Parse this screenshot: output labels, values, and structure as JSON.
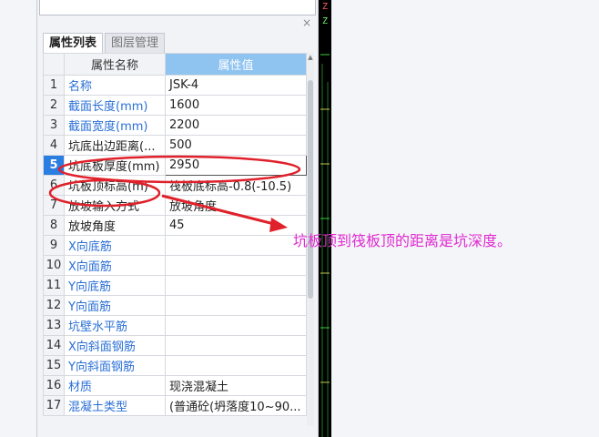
{
  "panel": {
    "tabs": [
      {
        "label": "属性列表",
        "active": true
      },
      {
        "label": "图层管理",
        "active": false
      }
    ],
    "close_glyph": "×",
    "header": {
      "index": "",
      "name": "属性名称",
      "value": "属性值"
    },
    "rows": [
      {
        "index": "1",
        "name": "名称",
        "value": "JSK-4",
        "name_color": "blue"
      },
      {
        "index": "2",
        "name": "截面长度(mm)",
        "value": "1600",
        "name_color": "blue"
      },
      {
        "index": "3",
        "name": "截面宽度(mm)",
        "value": "2200",
        "name_color": "blue"
      },
      {
        "index": "4",
        "name": "坑底出边距离(...",
        "value": "500",
        "name_color": "black"
      },
      {
        "index": "5",
        "name": "坑底板厚度(mm)",
        "value": "2950",
        "name_color": "black",
        "selected": true
      },
      {
        "index": "6",
        "name": "坑板顶标高(m)",
        "value": "筏板底标高-0.8(-10.5)",
        "name_color": "black"
      },
      {
        "index": "7",
        "name": "放坡输入方式",
        "value": "放坡角度",
        "name_color": "black"
      },
      {
        "index": "8",
        "name": "放坡角度",
        "value": "45",
        "name_color": "black"
      },
      {
        "index": "9",
        "name": "X向底筋",
        "value": "",
        "name_color": "blue"
      },
      {
        "index": "10",
        "name": "X向面筋",
        "value": "",
        "name_color": "blue"
      },
      {
        "index": "11",
        "name": "Y向底筋",
        "value": "",
        "name_color": "blue"
      },
      {
        "index": "12",
        "name": "Y向面筋",
        "value": "",
        "name_color": "blue"
      },
      {
        "index": "13",
        "name": "坑壁水平筋",
        "value": "",
        "name_color": "blue"
      },
      {
        "index": "14",
        "name": "X向斜面钢筋",
        "value": "",
        "name_color": "blue"
      },
      {
        "index": "15",
        "name": "Y向斜面钢筋",
        "value": "",
        "name_color": "blue"
      },
      {
        "index": "16",
        "name": "材质",
        "value": "现浇混凝土",
        "name_color": "blue"
      },
      {
        "index": "17",
        "name": "混凝土类型",
        "value": "(普通砼(坍落度10~90...",
        "name_color": "blue"
      }
    ]
  },
  "annotation": {
    "text": "坑板顶到筏板顶的距离是坑深度。",
    "color": "#e02ad0"
  },
  "markup": {
    "ellipse_color": "#e0202a",
    "arrow_color": "#e0202a"
  },
  "cad_canvas": {
    "background": "#000000",
    "glyph": "Z"
  }
}
